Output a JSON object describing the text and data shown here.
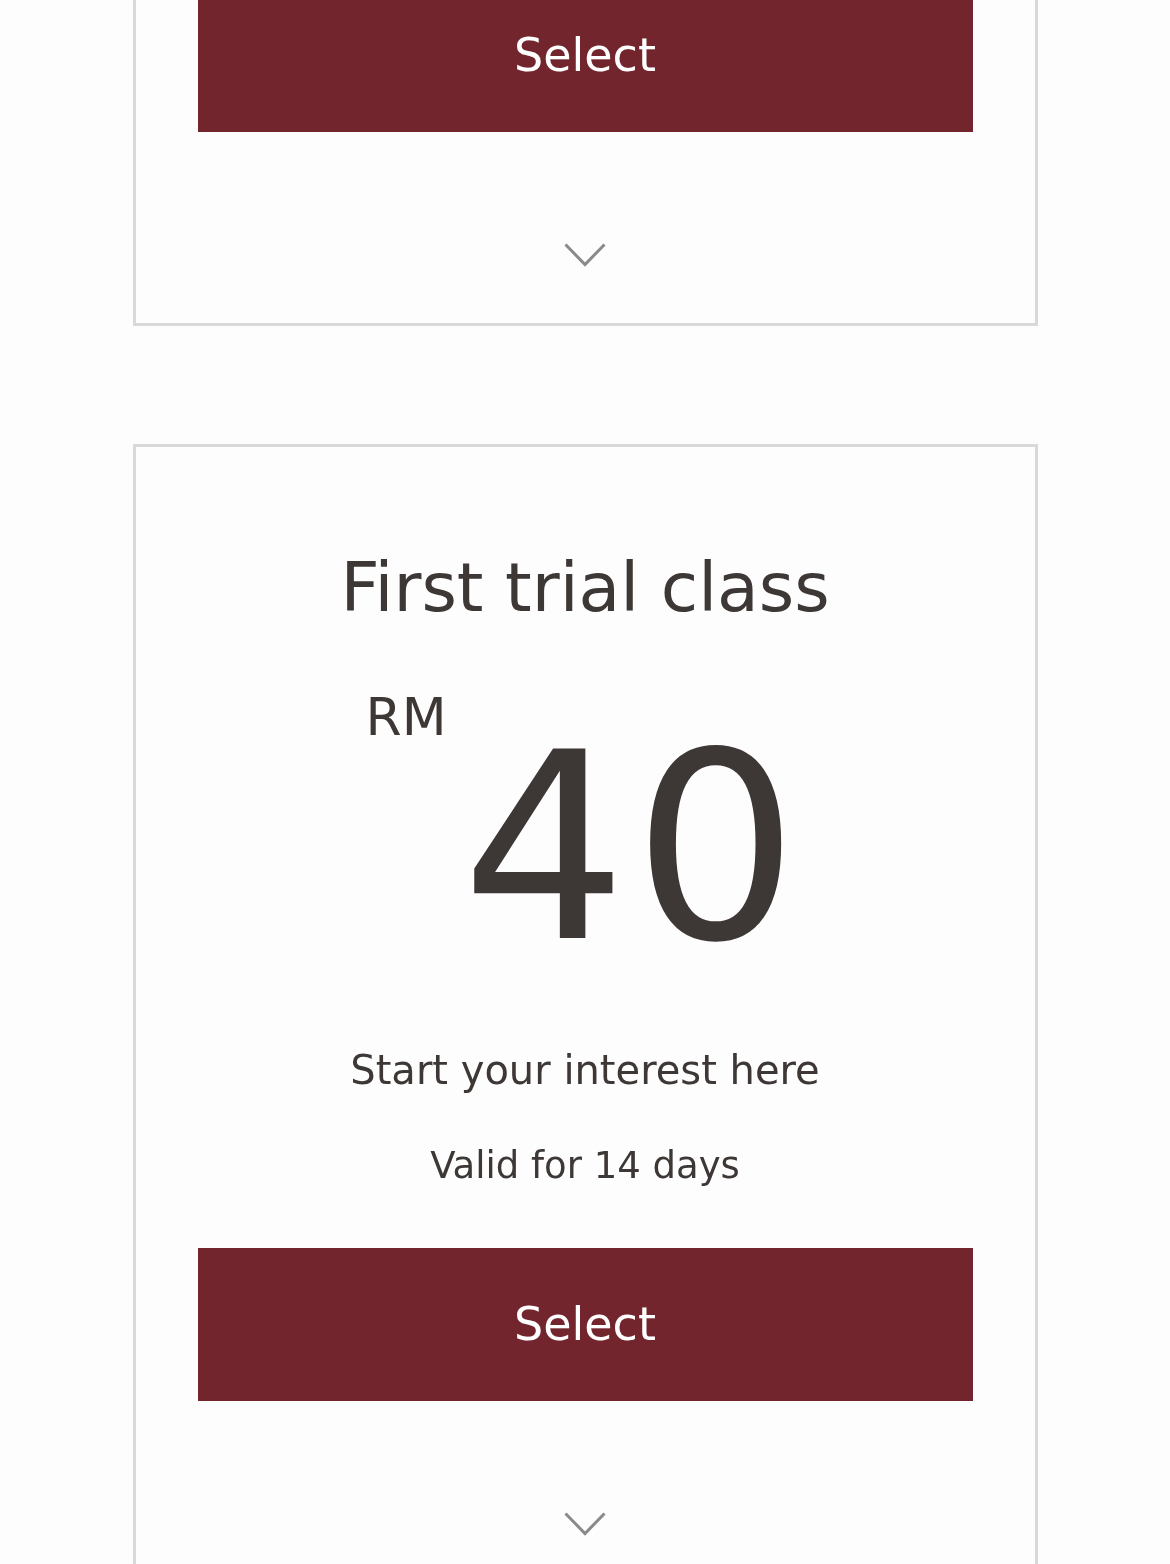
{
  "plans": [
    {
      "button": "Select",
      "expanded": false
    },
    {
      "title": "First trial class",
      "currency": "RM",
      "price": "40",
      "description": "Start your interest here",
      "validity": "Valid for 14 days",
      "button": "Select",
      "expanded": false
    }
  ]
}
